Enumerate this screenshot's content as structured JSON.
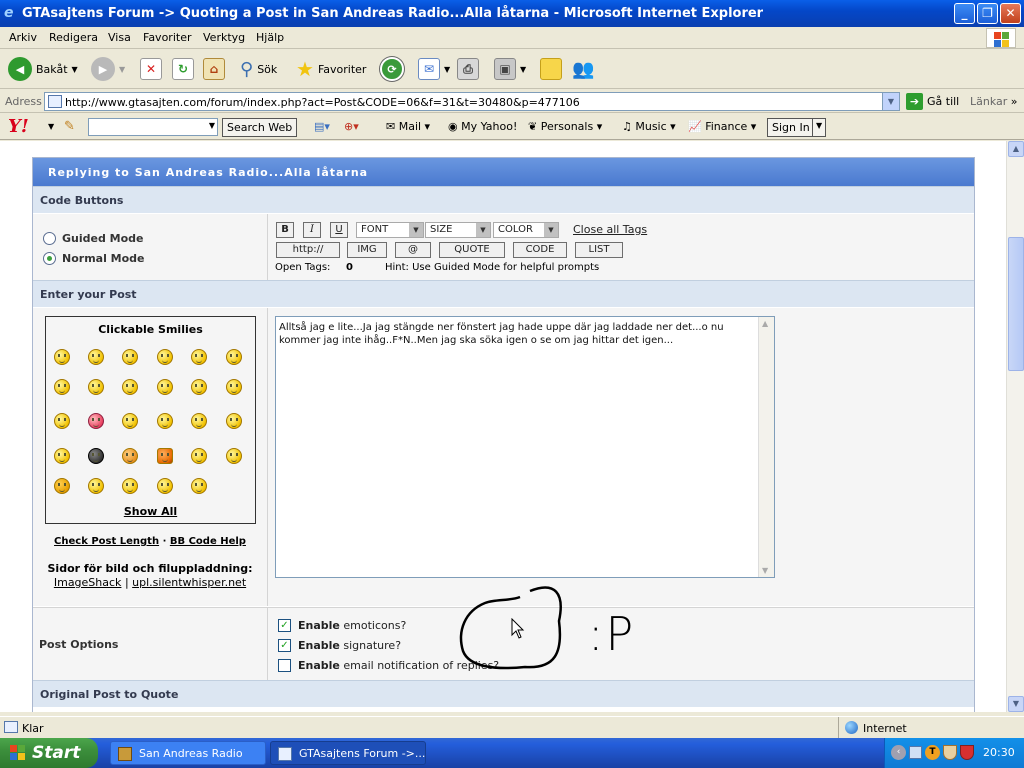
{
  "window": {
    "title": "GTAsajtens Forum -> Quoting a Post in San Andreas Radio...Alla låtarna - Microsoft Internet Explorer",
    "controls": {
      "minimize": "_",
      "maximize": "❐",
      "close": "✕"
    }
  },
  "menu": [
    "Arkiv",
    "Redigera",
    "Visa",
    "Favoriter",
    "Verktyg",
    "Hjälp"
  ],
  "toolbar": {
    "back": "Bakåt",
    "search": "Sök",
    "favorites": "Favoriter"
  },
  "address": {
    "label": "Adress",
    "url": "http://www.gtasajten.com/forum/index.php?act=Post&CODE=06&f=31&t=30480&p=477106",
    "go": "Gå till",
    "links": "Länkar"
  },
  "yahoo": {
    "logo": "Y!",
    "search_button": "Search Web",
    "items": [
      "Mail",
      "My Yahoo!",
      "Personals",
      "Music",
      "Finance"
    ],
    "sign_in": "Sign In"
  },
  "forum": {
    "header": "Replying to San Andreas Radio...Alla låtarna",
    "code_buttons_title": "Code Buttons",
    "modes": [
      "Guided Mode",
      "Normal Mode"
    ],
    "selected_mode": "Normal Mode",
    "format_buttons": {
      "bold": "B",
      "italic": "I",
      "underline": "U"
    },
    "selects": {
      "font": "FONT",
      "size": "SIZE",
      "color": "COLOR"
    },
    "close_tags": "Close all Tags",
    "tag_buttons": [
      "http://",
      "IMG",
      "@",
      "QUOTE",
      "CODE",
      "LIST"
    ],
    "open_tags_label": "Open Tags:",
    "open_tags_count": "0",
    "hint": "Hint: Use Guided Mode for helpful prompts",
    "enter_post_title": "Enter your Post",
    "smilies_title": "Clickable Smilies",
    "show_all": "Show All",
    "check_length": "Check Post Length",
    "separator": "·",
    "bbcode_help": "BB Code Help",
    "upload_label": "Sidor för bild och filuppladdning:",
    "upload_link_1": "ImageShack",
    "upload_sep": "|",
    "upload_link_2": "upl.silentwhisper.net",
    "post_text": "Alltså jag e lite...Ja jag stängde ner fönstert jag hade uppe där jag laddade ner det...o nu kommer jag inte ihåg..F*N..Men jag ska söka igen o se om jag hittar det igen...",
    "post_options_title": "Post Options",
    "options": [
      {
        "strong": "Enable",
        "rest": "emoticons?",
        "checked": true
      },
      {
        "strong": "Enable",
        "rest": "signature?",
        "checked": true
      },
      {
        "strong": "Enable",
        "rest": "email notification of replies?",
        "checked": false
      }
    ],
    "original_title": "Original Post to Quote"
  },
  "annotation": {
    "text": ":P"
  },
  "status": {
    "text": "Klar",
    "zone": "Internet"
  },
  "taskbar": {
    "start": "Start",
    "items": [
      "San Andreas Radio",
      "GTAsajtens Forum ->..."
    ],
    "clock": "20:30"
  },
  "colors": {
    "title_blue": "#0a5fe8",
    "forum_header": "#5a86d6",
    "section_bg": "#dce6f2",
    "start_green": "#3c8f3c"
  }
}
